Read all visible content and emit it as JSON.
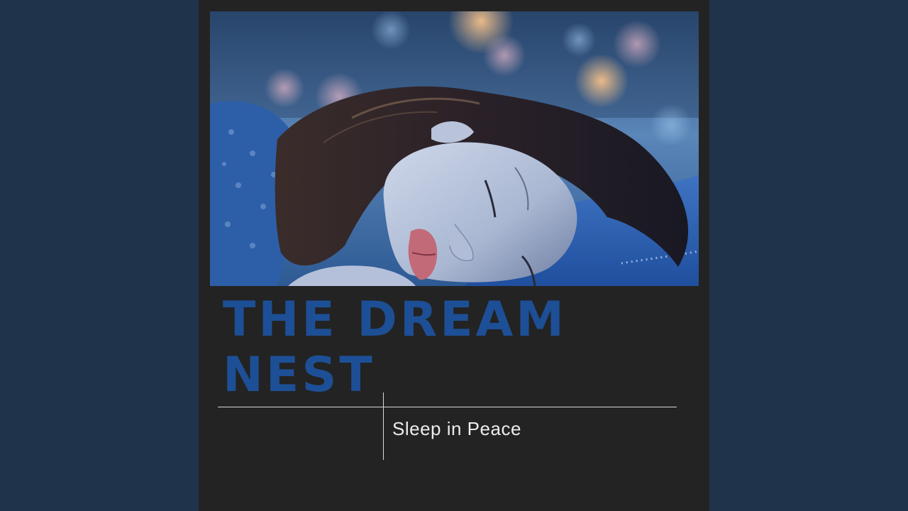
{
  "cover": {
    "title": "THE DREAM NEST",
    "subtitle": "Sleep in Peace",
    "photo_subject": "woman-sleeping"
  },
  "colors": {
    "page_background": "#1f334b",
    "cover_background": "#232323",
    "title": "#1d4f96",
    "subtitle": "#ececec",
    "rules": "#d9d9d9"
  }
}
